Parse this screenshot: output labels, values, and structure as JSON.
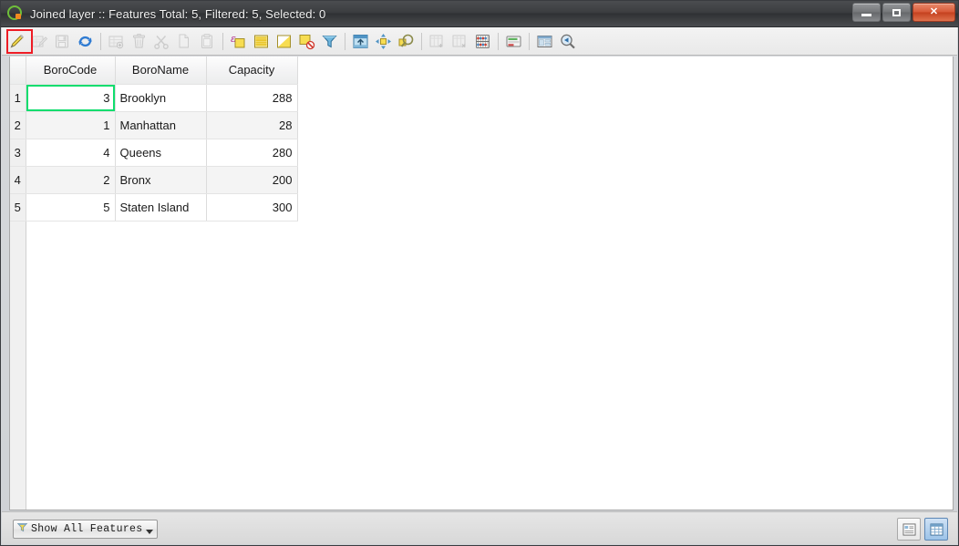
{
  "window": {
    "title": "Joined layer :: Features Total: 5, Filtered: 5, Selected: 0",
    "app_icon": "qgis-logo-icon",
    "controls": {
      "minimize": "minimize-button",
      "maximize": "maximize-button",
      "close_label": "✕"
    }
  },
  "toolbar": {
    "items": [
      {
        "name": "toggle-editing-icon",
        "tooltip": "Toggle editing mode",
        "enabled": true,
        "highlighted": true
      },
      {
        "name": "edit-pencil-table-icon",
        "tooltip": "Save edits",
        "enabled": false
      },
      {
        "name": "save-edits-icon",
        "tooltip": "Save edits",
        "enabled": false
      },
      {
        "name": "reload-icon",
        "tooltip": "Reload the table",
        "enabled": true
      },
      {
        "name": "new-field-icon",
        "tooltip": "New field",
        "enabled": false
      },
      {
        "name": "delete-field-icon",
        "tooltip": "Delete field",
        "enabled": false
      },
      {
        "name": "cut-icon",
        "tooltip": "Cut selected rows to clipboard",
        "enabled": false
      },
      {
        "name": "copy-icon",
        "tooltip": "Copy selected rows to clipboard",
        "enabled": false
      },
      {
        "name": "paste-icon",
        "tooltip": "Paste features from clipboard",
        "enabled": false
      },
      {
        "name": "select-by-expression-icon",
        "tooltip": "Select features using an expression",
        "enabled": true
      },
      {
        "name": "select-all-icon",
        "tooltip": "Select all",
        "enabled": true
      },
      {
        "name": "invert-selection-icon",
        "tooltip": "Invert selection",
        "enabled": true
      },
      {
        "name": "deselect-all-icon",
        "tooltip": "Deselect all",
        "enabled": true
      },
      {
        "name": "filter-funnel-icon",
        "tooltip": "Filter / Select features using form",
        "enabled": true
      },
      {
        "name": "move-selection-top-icon",
        "tooltip": "Move selection to top",
        "enabled": true
      },
      {
        "name": "pan-to-selection-icon",
        "tooltip": "Pan map to the selected rows",
        "enabled": true
      },
      {
        "name": "zoom-to-selection-icon",
        "tooltip": "Zoom map to the selected rows",
        "enabled": true
      },
      {
        "name": "new-column-icon",
        "tooltip": "New column",
        "enabled": false
      },
      {
        "name": "delete-column-icon",
        "tooltip": "Delete column",
        "enabled": false
      },
      {
        "name": "field-calculator-icon",
        "tooltip": "Open field calculator",
        "enabled": true
      },
      {
        "name": "conditional-formatting-icon",
        "tooltip": "Conditional formatting",
        "enabled": true
      },
      {
        "name": "organize-columns-icon",
        "tooltip": "Organize columns",
        "enabled": true
      },
      {
        "name": "actions-icon",
        "tooltip": "Actions",
        "enabled": true
      }
    ]
  },
  "table": {
    "columns": [
      "BoroCode",
      "BoroName",
      "Capacity"
    ],
    "selected_cell": {
      "row": 1,
      "column": "BoroCode"
    },
    "rows": [
      {
        "n": "1",
        "BoroCode": "3",
        "BoroName": "Brooklyn",
        "Capacity": "288"
      },
      {
        "n": "2",
        "BoroCode": "1",
        "BoroName": "Manhattan",
        "Capacity": "28"
      },
      {
        "n": "3",
        "BoroCode": "4",
        "BoroName": "Queens",
        "Capacity": "280"
      },
      {
        "n": "4",
        "BoroCode": "2",
        "BoroName": "Bronx",
        "Capacity": "200"
      },
      {
        "n": "5",
        "BoroCode": "5",
        "BoroName": "Staten Island",
        "Capacity": "300"
      }
    ]
  },
  "statusbar": {
    "filter_label": "Show All Features",
    "filter_icon": "filter-funnel-icon",
    "view_form_icon": "form-view-icon",
    "view_table_icon": "table-view-icon",
    "active_view": "table"
  },
  "colors": {
    "selection_green": "#10dd6e",
    "annotation_red": "#ee1c25",
    "accent_yellow": "#f2d230",
    "active_blue": "#9cc3e8"
  }
}
